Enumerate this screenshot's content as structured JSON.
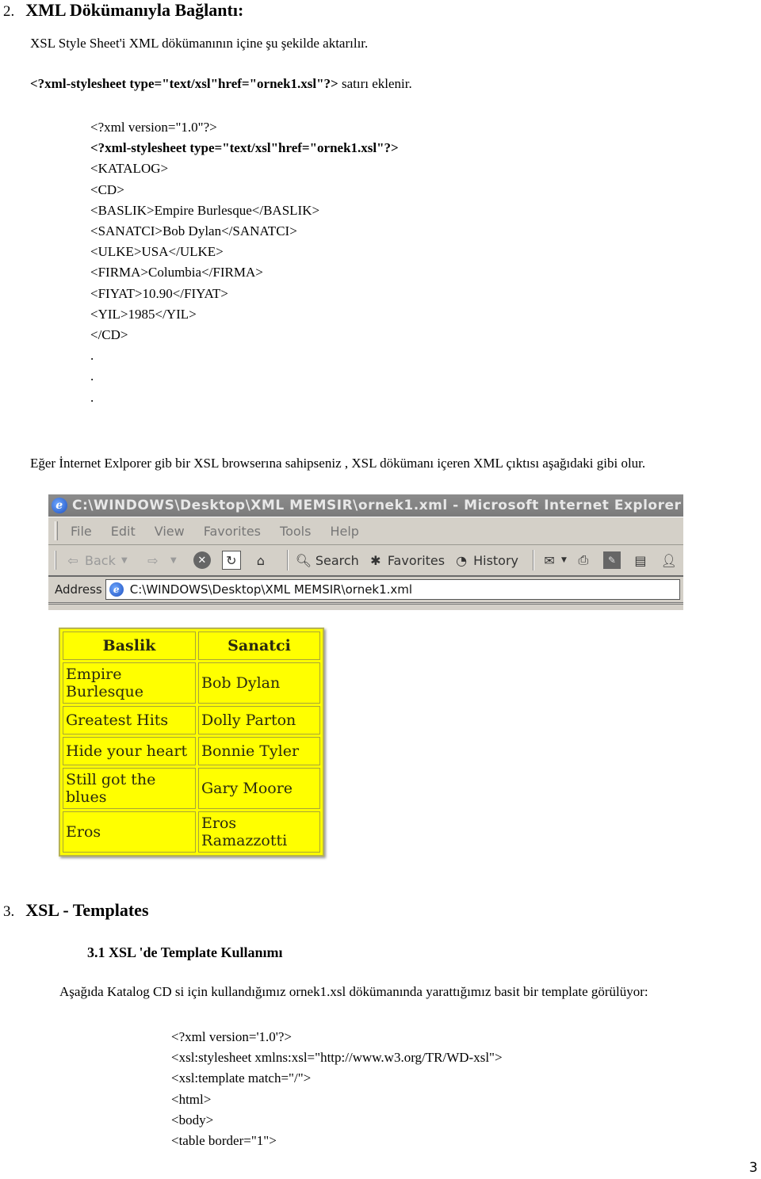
{
  "section2": {
    "number": "2.",
    "title": "XML Dökümanıyla Bağlantı:",
    "intro": "XSL Style Sheet'i XML dökümanının içine şu şekilde aktarılır.",
    "pi_bold": "<?xml-stylesheet type=\"text/xsl\"href=\"ornek1.xsl\"?>",
    "pi_suffix": " satırı eklenir.",
    "code_lines": [
      "<?xml version=\"1.0\"?>",
      "<?xml-stylesheet type=\"text/xsl\"href=\"ornek1.xsl\"?>",
      "<KATALOG>",
      "<CD>",
      "<BASLIK>Empire Burlesque</BASLIK>",
      "<SANATCI>Bob Dylan</SANATCI>",
      "<ULKE>USA</ULKE>",
      "<FIRMA>Columbia</FIRMA>",
      "<FIYAT>10.90</FIYAT>",
      "<YIL>1985</YIL>",
      "</CD>",
      ".",
      ".",
      "."
    ],
    "explanation": "Eğer İnternet Exlporer gib bir XSL browserına sahipseniz , XSL dökümanı içeren XML çıktısı aşağıdaki gibi olur."
  },
  "browser": {
    "title": "C:\\WINDOWS\\Desktop\\XML MEMSIR\\ornek1.xml - Microsoft Internet Explorer",
    "menu": [
      "File",
      "Edit",
      "View",
      "Favorites",
      "Tools",
      "Help"
    ],
    "toolbar": {
      "back": "Back",
      "search": "Search",
      "favorites": "Favorites",
      "history": "History"
    },
    "address_label": "Address",
    "address_value": "C:\\WINDOWS\\Desktop\\XML MEMSIR\\ornek1.xml"
  },
  "result_table": {
    "headers": [
      "Baslik",
      "Sanatci"
    ],
    "rows": [
      [
        "Empire Burlesque",
        "Bob Dylan"
      ],
      [
        "Greatest Hits",
        "Dolly Parton"
      ],
      [
        "Hide your heart",
        "Bonnie Tyler"
      ],
      [
        "Still got the blues",
        "Gary Moore"
      ],
      [
        "Eros",
        "Eros Ramazzotti"
      ]
    ],
    "background_color": "#ffff00"
  },
  "section3": {
    "number": "3.",
    "title": "XSL - Templates",
    "subsection": "3.1  XSL 'de Template Kullanımı",
    "intro": "Aşağıda Katalog CD si için kullandığımız ornek1.xsl dökümanında yarattığımız basit bir template görülüyor:",
    "code_lines": [
      "<?xml version='1.0'?>",
      "<xsl:stylesheet xmlns:xsl=\"http://www.w3.org/TR/WD-xsl\">",
      "<xsl:template match=\"/\">",
      "<html>",
      "<body>",
      "<table border=\"1\">"
    ]
  },
  "page_number": "3"
}
